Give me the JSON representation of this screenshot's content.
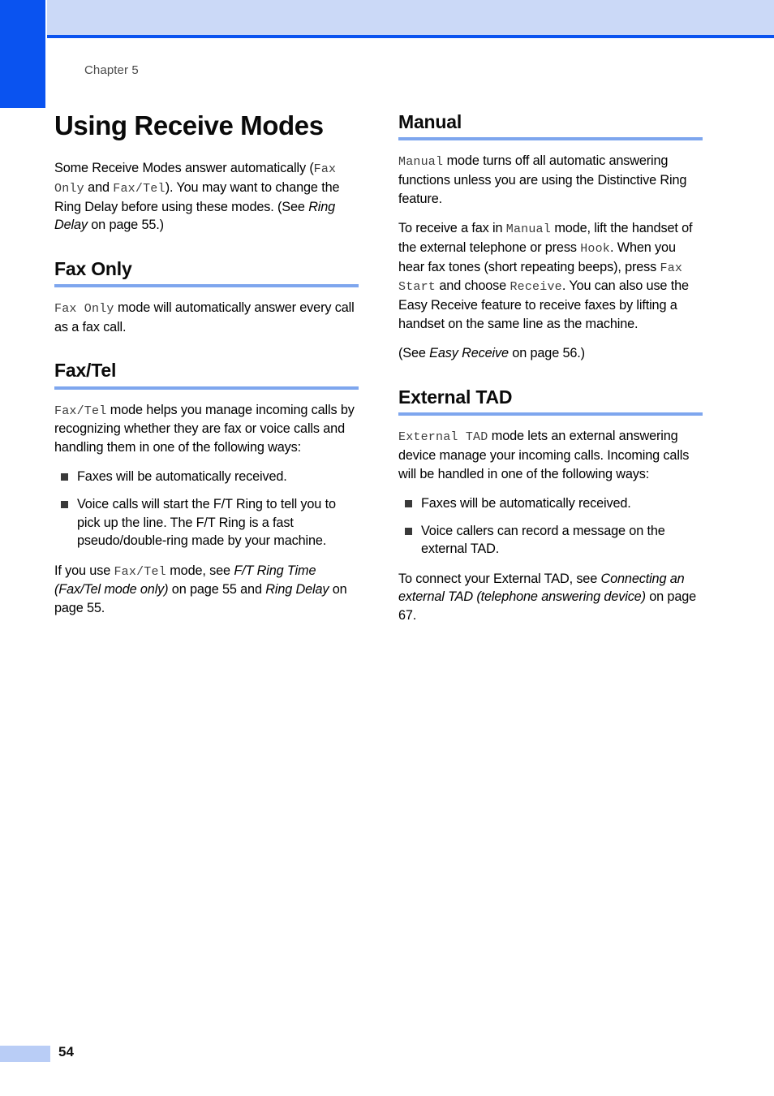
{
  "page": {
    "running_head": "Chapter 5",
    "page_number": "54",
    "title": "Using Receive Modes",
    "accent_blue": "#0a53f0",
    "band_blue": "#cbd9f7",
    "rule_blue": "#7ea6ee",
    "footer_tab_blue": "#b9cdf6"
  },
  "intro": {
    "t1": "Some Receive Modes answer automatically (",
    "m1": "Fax Only",
    "t2": " and ",
    "m2": "Fax/Tel",
    "t3": "). You may want to change the Ring Delay before using these modes. (See ",
    "i1": "Ring Delay",
    "t4": " on page 55.)"
  },
  "left_column": {
    "sections": [
      {
        "heading": "Fax Only",
        "p1_m1": "Fax Only",
        "p1_t1": " mode will automatically answer every call as a fax call."
      },
      {
        "heading": "Fax/Tel",
        "p1_m1": "Fax/Tel",
        "p1_t1": " mode helps you manage incoming calls by recognizing whether they are fax or voice calls and handling them in one of the following ways:",
        "bullets": [
          "Faxes will be automatically received.",
          "Voice calls will start the F/T Ring to tell you to pick up the line. The F/T Ring is a fast pseudo/double-ring made by your machine."
        ],
        "p2_t1": "If you use ",
        "p2_m1": "Fax/Tel",
        "p2_t2": " mode, see ",
        "p2_i1": "F/T Ring Time (Fax/Tel mode only)",
        "p2_t3": " on page 55 and ",
        "p2_i2": "Ring Delay",
        "p2_t4": " on page 55."
      }
    ]
  },
  "right_column": {
    "sections": [
      {
        "heading": "Manual",
        "p1_m1": "Manual",
        "p1_t1": " mode turns off all automatic answering functions unless you are using the Distinctive Ring feature.",
        "p2_t1": "To receive a fax in ",
        "p2_m1": "Manual",
        "p2_t2": " mode, lift the handset of the external telephone or press ",
        "p2_m2": "Hook",
        "p2_t3": ". When you hear fax tones (short repeating beeps), press ",
        "p2_m3": "Fax Start",
        "p2_t4": " and choose ",
        "p2_m4": "Receive",
        "p2_t5": ". You can also use the Easy Receive feature to receive faxes by lifting a handset on the same line as the machine.",
        "p3_t1": "(See ",
        "p3_i1": "Easy Receive",
        "p3_t2": " on page 56.)"
      },
      {
        "heading": "External TAD",
        "p1_m1": "External TAD",
        "p1_t1": " mode lets an external answering device manage your incoming calls. Incoming calls will be handled in one of the following ways:",
        "bullets": [
          "Faxes will be automatically received.",
          "Voice callers can record a message on the external TAD."
        ],
        "p2_t1": "To connect your External TAD, see ",
        "p2_i1": "Connecting an external TAD (telephone answering device)",
        "p2_t2": " on page 67."
      }
    ]
  }
}
